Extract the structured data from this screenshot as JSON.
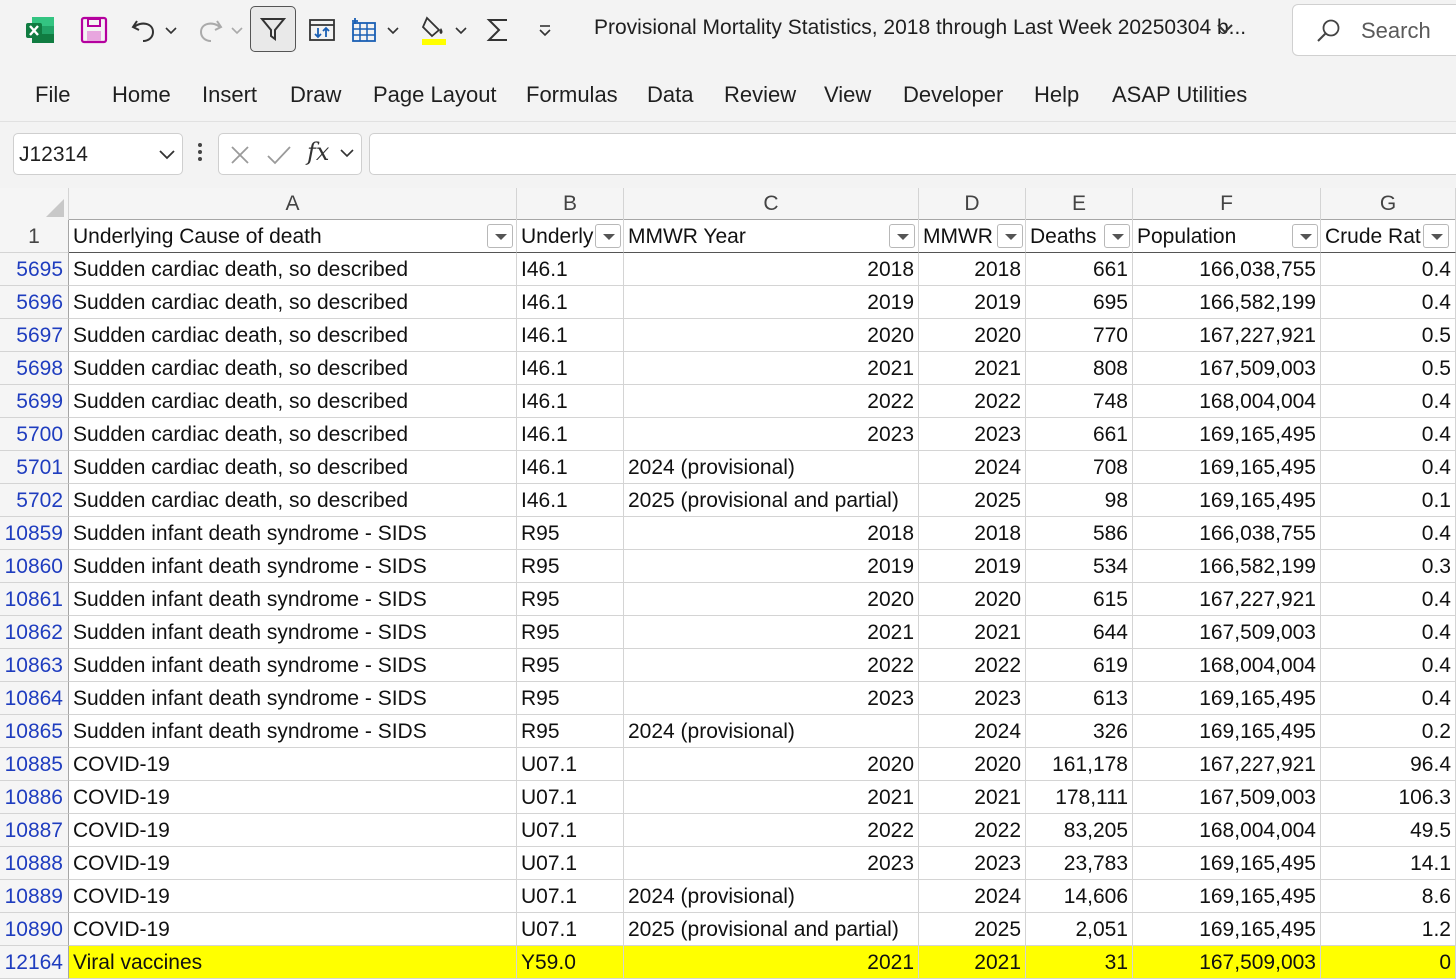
{
  "window": {
    "title": "Provisional Mortality Statistics, 2018 through Last Week 20250304 b...",
    "search_label": "Search"
  },
  "quick_access": {
    "icons": [
      "excel-logo-icon",
      "save-icon",
      "undo-icon",
      "redo-icon",
      "filter-icon",
      "sort-icon",
      "insert-table-icon",
      "fill-color-icon",
      "autosum-icon",
      "customize-toolbar-icon"
    ]
  },
  "ribbon": {
    "tabs": [
      "File",
      "Home",
      "Insert",
      "Draw",
      "Page Layout",
      "Formulas",
      "Data",
      "Review",
      "View",
      "Developer",
      "Help",
      "ASAP Utilities"
    ]
  },
  "formula_bar": {
    "name_box": "J12314",
    "formula": ""
  },
  "sheet": {
    "columns": [
      "A",
      "B",
      "C",
      "D",
      "E",
      "F",
      "G"
    ],
    "header_row_number": "1",
    "headers": [
      "Underlying Cause of death",
      "Underly",
      "MMWR Year",
      "MMWR",
      "Deaths",
      "Population",
      "Crude Rat"
    ],
    "highlight_color": "#ffff00",
    "rows": [
      {
        "num": "5695",
        "cells": [
          "Sudden cardiac death, so described",
          "I46.1",
          "2018",
          "2018",
          "661",
          "166,038,755",
          "0.4"
        ]
      },
      {
        "num": "5696",
        "cells": [
          "Sudden cardiac death, so described",
          "I46.1",
          "2019",
          "2019",
          "695",
          "166,582,199",
          "0.4"
        ]
      },
      {
        "num": "5697",
        "cells": [
          "Sudden cardiac death, so described",
          "I46.1",
          "2020",
          "2020",
          "770",
          "167,227,921",
          "0.5"
        ]
      },
      {
        "num": "5698",
        "cells": [
          "Sudden cardiac death, so described",
          "I46.1",
          "2021",
          "2021",
          "808",
          "167,509,003",
          "0.5"
        ]
      },
      {
        "num": "5699",
        "cells": [
          "Sudden cardiac death, so described",
          "I46.1",
          "2022",
          "2022",
          "748",
          "168,004,004",
          "0.4"
        ]
      },
      {
        "num": "5700",
        "cells": [
          "Sudden cardiac death, so described",
          "I46.1",
          "2023",
          "2023",
          "661",
          "169,165,495",
          "0.4"
        ]
      },
      {
        "num": "5701",
        "cells": [
          "Sudden cardiac death, so described",
          "I46.1",
          "2024 (provisional)",
          "2024",
          "708",
          "169,165,495",
          "0.4"
        ]
      },
      {
        "num": "5702",
        "cells": [
          "Sudden cardiac death, so described",
          "I46.1",
          "2025 (provisional and partial)",
          "2025",
          "98",
          "169,165,495",
          "0.1"
        ]
      },
      {
        "num": "10859",
        "cells": [
          "Sudden infant death syndrome - SIDS",
          "R95",
          "2018",
          "2018",
          "586",
          "166,038,755",
          "0.4"
        ]
      },
      {
        "num": "10860",
        "cells": [
          "Sudden infant death syndrome - SIDS",
          "R95",
          "2019",
          "2019",
          "534",
          "166,582,199",
          "0.3"
        ]
      },
      {
        "num": "10861",
        "cells": [
          "Sudden infant death syndrome - SIDS",
          "R95",
          "2020",
          "2020",
          "615",
          "167,227,921",
          "0.4"
        ]
      },
      {
        "num": "10862",
        "cells": [
          "Sudden infant death syndrome - SIDS",
          "R95",
          "2021",
          "2021",
          "644",
          "167,509,003",
          "0.4"
        ]
      },
      {
        "num": "10863",
        "cells": [
          "Sudden infant death syndrome - SIDS",
          "R95",
          "2022",
          "2022",
          "619",
          "168,004,004",
          "0.4"
        ]
      },
      {
        "num": "10864",
        "cells": [
          "Sudden infant death syndrome - SIDS",
          "R95",
          "2023",
          "2023",
          "613",
          "169,165,495",
          "0.4"
        ]
      },
      {
        "num": "10865",
        "cells": [
          "Sudden infant death syndrome - SIDS",
          "R95",
          "2024 (provisional)",
          "2024",
          "326",
          "169,165,495",
          "0.2"
        ]
      },
      {
        "num": "10885",
        "cells": [
          "COVID-19",
          "U07.1",
          "2020",
          "2020",
          "161,178",
          "167,227,921",
          "96.4"
        ]
      },
      {
        "num": "10886",
        "cells": [
          "COVID-19",
          "U07.1",
          "2021",
          "2021",
          "178,111",
          "167,509,003",
          "106.3"
        ]
      },
      {
        "num": "10887",
        "cells": [
          "COVID-19",
          "U07.1",
          "2022",
          "2022",
          "83,205",
          "168,004,004",
          "49.5"
        ]
      },
      {
        "num": "10888",
        "cells": [
          "COVID-19",
          "U07.1",
          "2023",
          "2023",
          "23,783",
          "169,165,495",
          "14.1"
        ]
      },
      {
        "num": "10889",
        "cells": [
          "COVID-19",
          "U07.1",
          "2024 (provisional)",
          "2024",
          "14,606",
          "169,165,495",
          "8.6"
        ]
      },
      {
        "num": "10890",
        "cells": [
          "COVID-19",
          "U07.1",
          "2025 (provisional and partial)",
          "2025",
          "2,051",
          "169,165,495",
          "1.2"
        ]
      },
      {
        "num": "12164",
        "highlighted": true,
        "cells": [
          "Viral vaccines",
          "Y59.0",
          "2021",
          "2021",
          "31",
          "167,509,003",
          "0"
        ]
      }
    ]
  }
}
